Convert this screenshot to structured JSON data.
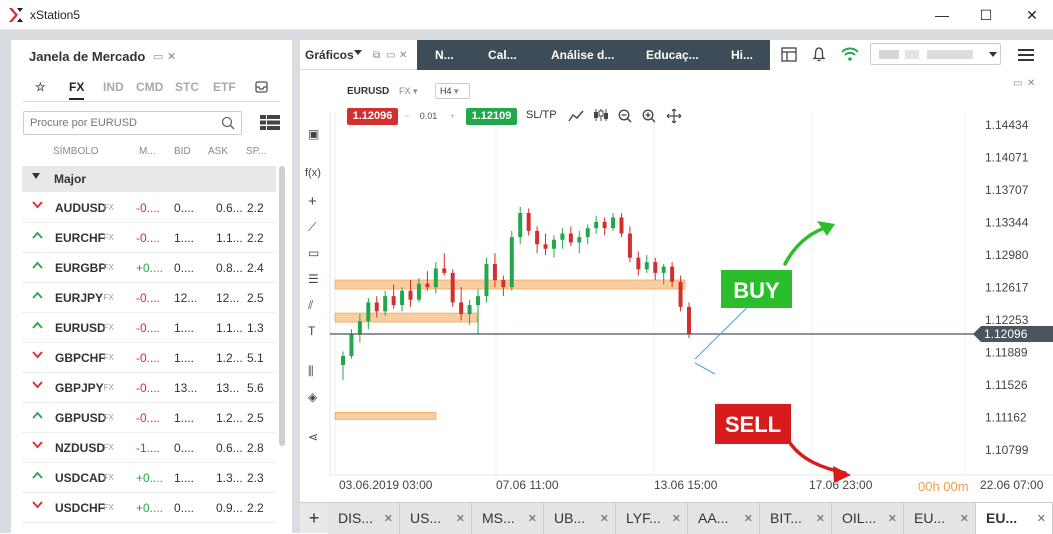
{
  "app": {
    "title": "xStation5",
    "window_minimize": "—",
    "window_maximize": "☐",
    "window_close": "✕"
  },
  "market": {
    "title": "Janela de Mercado",
    "tabs": [
      "FX",
      "IND",
      "CMD",
      "STC",
      "ETF"
    ],
    "active_tab": "FX",
    "search_placeholder": "Procure por EURUSD",
    "columns": {
      "symbol": "SÍMBOLO",
      "change": "M...",
      "bid": "BID",
      "ask": "ASK",
      "spread": "SP..."
    },
    "group": "Major",
    "rows": [
      {
        "symbol": "AUDUSD",
        "type": "FX",
        "dir": "down",
        "change": "-0....",
        "bid": "0....",
        "ask": "0.6...",
        "spread": "2.2"
      },
      {
        "symbol": "EURCHF",
        "type": "FX",
        "dir": "up",
        "change": "-0....",
        "bid": "1....",
        "ask": "1.1...",
        "spread": "2.2"
      },
      {
        "symbol": "EURGBP",
        "type": "FX",
        "dir": "up",
        "change": "+0....",
        "bid": "0....",
        "ask": "0.8...",
        "spread": "2.4"
      },
      {
        "symbol": "EURJPY",
        "type": "FX",
        "dir": "up",
        "change": "-0....",
        "bid": "12...",
        "ask": "12...",
        "spread": "2.5"
      },
      {
        "symbol": "EURUSD",
        "type": "FX",
        "dir": "up",
        "change": "-0....",
        "bid": "1....",
        "ask": "1.1...",
        "spread": "1.3"
      },
      {
        "symbol": "GBPCHF",
        "type": "FX",
        "dir": "down",
        "change": "-0....",
        "bid": "1....",
        "ask": "1.2...",
        "spread": "5.1"
      },
      {
        "symbol": "GBPJPY",
        "type": "FX",
        "dir": "down",
        "change": "-0....",
        "bid": "13...",
        "ask": "13...",
        "spread": "5.6"
      },
      {
        "symbol": "GBPUSD",
        "type": "FX",
        "dir": "up",
        "change": "-0....",
        "bid": "1....",
        "ask": "1.2...",
        "spread": "2.5"
      },
      {
        "symbol": "NZDUSD",
        "type": "FX",
        "dir": "down",
        "change": "-1....",
        "bid": "0....",
        "ask": "0.6...",
        "spread": "2.8"
      },
      {
        "symbol": "USDCAD",
        "type": "FX",
        "dir": "up",
        "change": "+0....",
        "bid": "1....",
        "ask": "1.3...",
        "spread": "2.3"
      },
      {
        "symbol": "USDCHF",
        "type": "FX",
        "dir": "down",
        "change": "+0....",
        "bid": "0....",
        "ask": "0.9...",
        "spread": "2.2"
      }
    ]
  },
  "charts_panel": {
    "main_tab": "Gráficos",
    "nav_tabs": [
      "N...",
      "Cal...",
      "Análise d...",
      "Educaç...",
      "Hi..."
    ]
  },
  "chart": {
    "symbol": "EURUSD",
    "symbol_type": "FX",
    "timeframe": "H4",
    "sell_price": "1.12096",
    "buy_price": "1.12109",
    "lot": "0.01",
    "sltp_label": "SL/TP",
    "price_ticks": [
      "1.14434",
      "1.14071",
      "1.13707",
      "1.13344",
      "1.12980",
      "1.12617",
      "1.12253",
      "1.11889",
      "1.11526",
      "1.11162",
      "1.10799"
    ],
    "current_price": "1.12096",
    "time_ticks": [
      "03.06.2019 03:00",
      "07.06 11:00",
      "13.06 15:00",
      "17.06 23:00",
      "22.06 07:00"
    ],
    "buy_label": "BUY",
    "sell_label": "SELL",
    "timer": "00h 00m",
    "colors": {
      "up": "#23a74c",
      "down": "#d32f2f",
      "zone": "#f7c48f",
      "buy_arrow": "#2bbd2b",
      "sell_arrow": "#d81b1b"
    }
  },
  "chart_data": {
    "type": "candlestick",
    "symbol": "EURUSD",
    "timeframe": "H4",
    "x_range": [
      "03.06.2019 03:00",
      "22.06 07:00"
    ],
    "ylim": [
      1.10799,
      1.14434
    ],
    "last": 1.12096,
    "zones": [
      [
        1.127,
        1.126
      ],
      [
        1.1233,
        1.1223
      ],
      [
        1.1122,
        1.1116
      ]
    ],
    "candles": [
      [
        1.1175,
        1.119,
        1.1158,
        1.1185
      ],
      [
        1.1185,
        1.1215,
        1.1182,
        1.121
      ],
      [
        1.121,
        1.1232,
        1.12,
        1.1224
      ],
      [
        1.1224,
        1.125,
        1.1215,
        1.1245
      ],
      [
        1.1245,
        1.1252,
        1.1228,
        1.1235
      ],
      [
        1.1235,
        1.1258,
        1.123,
        1.1252
      ],
      [
        1.1252,
        1.1265,
        1.1238,
        1.1242
      ],
      [
        1.1242,
        1.1262,
        1.1235,
        1.1258
      ],
      [
        1.1258,
        1.127,
        1.124,
        1.1248
      ],
      [
        1.1248,
        1.1272,
        1.1245,
        1.1266
      ],
      [
        1.1266,
        1.128,
        1.1258,
        1.1262
      ],
      [
        1.1262,
        1.129,
        1.1255,
        1.1283
      ],
      [
        1.1283,
        1.13,
        1.1275,
        1.1278
      ],
      [
        1.1278,
        1.1282,
        1.124,
        1.1245
      ],
      [
        1.1245,
        1.1262,
        1.1225,
        1.1232
      ],
      [
        1.1232,
        1.1248,
        1.122,
        1.1242
      ],
      [
        1.1242,
        1.126,
        1.121,
        1.1252
      ],
      [
        1.1252,
        1.1295,
        1.1245,
        1.1288
      ],
      [
        1.1288,
        1.13,
        1.1262,
        1.127
      ],
      [
        1.127,
        1.1275,
        1.1252,
        1.1262
      ],
      [
        1.1262,
        1.1325,
        1.1258,
        1.1318
      ],
      [
        1.1318,
        1.1352,
        1.131,
        1.1345
      ],
      [
        1.1345,
        1.135,
        1.132,
        1.1325
      ],
      [
        1.1325,
        1.133,
        1.13,
        1.131
      ],
      [
        1.131,
        1.1322,
        1.1298,
        1.1305
      ],
      [
        1.1305,
        1.132,
        1.1295,
        1.1315
      ],
      [
        1.1315,
        1.1328,
        1.1305,
        1.1322
      ],
      [
        1.1322,
        1.133,
        1.1308,
        1.1312
      ],
      [
        1.1312,
        1.1325,
        1.13,
        1.1318
      ],
      [
        1.1318,
        1.1332,
        1.131,
        1.1328
      ],
      [
        1.1328,
        1.1342,
        1.1322,
        1.1335
      ],
      [
        1.1335,
        1.134,
        1.132,
        1.1328
      ],
      [
        1.1328,
        1.1345,
        1.1325,
        1.134
      ],
      [
        1.134,
        1.1345,
        1.1318,
        1.1322
      ],
      [
        1.1322,
        1.133,
        1.129,
        1.1295
      ],
      [
        1.1295,
        1.1302,
        1.1275,
        1.1282
      ],
      [
        1.1282,
        1.1298,
        1.1278,
        1.129
      ],
      [
        1.129,
        1.1295,
        1.127,
        1.1278
      ],
      [
        1.1278,
        1.1288,
        1.1265,
        1.1285
      ],
      [
        1.1285,
        1.129,
        1.1262,
        1.1268
      ],
      [
        1.1268,
        1.1275,
        1.1235,
        1.124
      ],
      [
        1.124,
        1.1245,
        1.1205,
        1.121
      ]
    ]
  },
  "bottom_tabs": [
    "DIS...",
    "US...",
    "MS...",
    "UB...",
    "LYF...",
    "AA...",
    "BIT...",
    "OIL...",
    "EU...",
    "EU..."
  ],
  "bottom_active": 9
}
